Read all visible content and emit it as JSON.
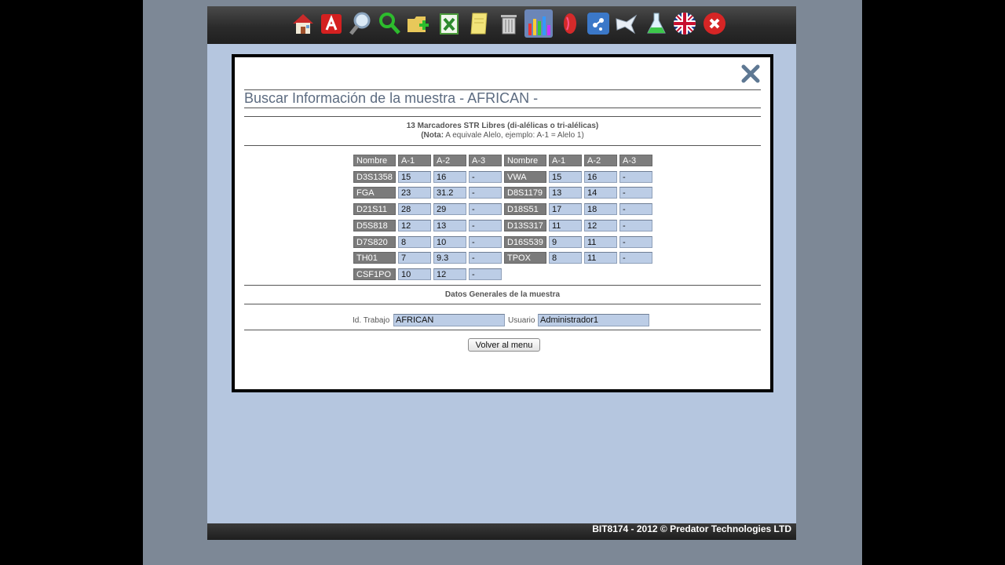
{
  "toolbar": {
    "icons": [
      "home-icon",
      "acrobat-icon",
      "search-magnifier-icon",
      "green-magnifier-icon",
      "folder-add-icon",
      "spreadsheet-icon",
      "note-icon",
      "trash-icon",
      "statistics-chart-icon",
      "pill-icon",
      "dna-dropper-icon",
      "bird-icon",
      "flask-icon",
      "uk-flag-icon",
      "close-x-icon"
    ]
  },
  "modal": {
    "title": "Buscar Información de la muestra - AFRICAN -",
    "markers_heading": "13 Marcadores STR Libres (di-alélicas o tri-alélicas)",
    "note_label": "(Nota:",
    "note_text": " A equivale Alelo, ejemplo: A-1 = Alelo 1)",
    "table_headers": [
      "Nombre",
      "A-1",
      "A-2",
      "A-3",
      "Nombre",
      "A-1",
      "A-2",
      "A-3"
    ],
    "left_markers": [
      {
        "name": "D3S1358",
        "a1": "15",
        "a2": "16",
        "a3": "-"
      },
      {
        "name": "FGA",
        "a1": "23",
        "a2": "31.2",
        "a3": "-"
      },
      {
        "name": "D21S11",
        "a1": "28",
        "a2": "29",
        "a3": "-"
      },
      {
        "name": "D5S818",
        "a1": "12",
        "a2": "13",
        "a3": "-"
      },
      {
        "name": "D7S820",
        "a1": "8",
        "a2": "10",
        "a3": "-"
      },
      {
        "name": "TH01",
        "a1": "7",
        "a2": "9.3",
        "a3": "-"
      },
      {
        "name": "CSF1PO",
        "a1": "10",
        "a2": "12",
        "a3": "-"
      }
    ],
    "right_markers": [
      {
        "name": "VWA",
        "a1": "15",
        "a2": "16",
        "a3": "-"
      },
      {
        "name": "D8S1179",
        "a1": "13",
        "a2": "14",
        "a3": "-"
      },
      {
        "name": "D18S51",
        "a1": "17",
        "a2": "18",
        "a3": "-"
      },
      {
        "name": "D13S317",
        "a1": "11",
        "a2": "12",
        "a3": "-"
      },
      {
        "name": "D16S539",
        "a1": "9",
        "a2": "11",
        "a3": "-"
      },
      {
        "name": "TPOX",
        "a1": "8",
        "a2": "11",
        "a3": "-"
      }
    ],
    "datos_heading": "Datos Generales de la muestra",
    "id_trabajo_label": "Id. Trabajo",
    "id_trabajo_value": "AFRICAN",
    "usuario_label": "Usuario",
    "usuario_value": "Administrador1",
    "volver_label": "Volver al menu"
  },
  "footer": {
    "text": "BIT8174 - 2012 ©  Predator Technologies LTD"
  }
}
